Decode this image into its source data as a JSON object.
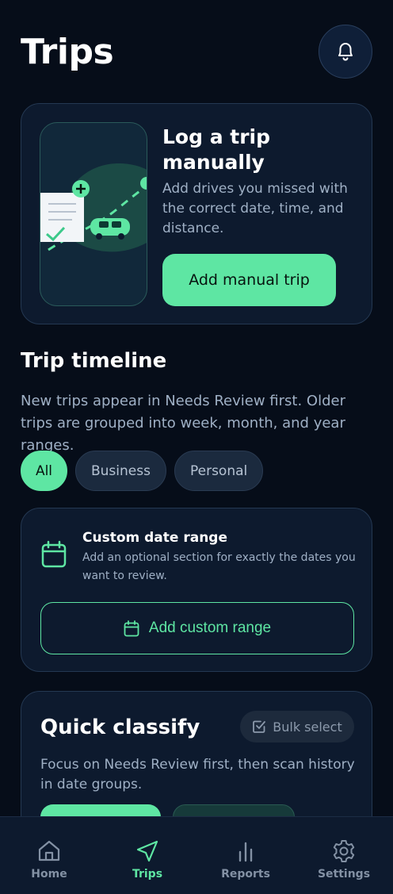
{
  "header": {
    "title": "Trips",
    "bell_icon": "bell-icon"
  },
  "manual_card": {
    "title": "Log a trip manually",
    "description": "Add drives you missed with the correct date, time, and distance.",
    "button_label": "Add manual trip",
    "illustration_icons": [
      "document-icon",
      "plus-icon",
      "check-icon",
      "car-icon",
      "location-pin-icon"
    ]
  },
  "timeline": {
    "title": "Trip timeline",
    "description": "New trips appear in Needs Review first. Older trips are grouped into week, month, and year ranges.",
    "filters": [
      {
        "label": "All",
        "active": true
      },
      {
        "label": "Business",
        "active": false
      },
      {
        "label": "Personal",
        "active": false
      }
    ]
  },
  "custom_range": {
    "title": "Custom date range",
    "description": "Add an optional section for exactly the dates you want to review.",
    "button_label": "Add custom range",
    "icon": "calendar-icon"
  },
  "quick_classify": {
    "title": "Quick classify",
    "bulk_label": "Bulk select",
    "bulk_icon": "checkbox-icon",
    "description": "Focus on Needs Review first, then scan history in date groups."
  },
  "nav": {
    "items": [
      {
        "label": "Home",
        "icon": "home-icon",
        "active": false
      },
      {
        "label": "Trips",
        "icon": "navigation-arrow-icon",
        "active": true
      },
      {
        "label": "Reports",
        "icon": "bar-chart-icon",
        "active": false
      },
      {
        "label": "Settings",
        "icon": "gear-icon",
        "active": false
      }
    ]
  },
  "colors": {
    "background": "#060d19",
    "card": "#0d1a2e",
    "accent": "#5ee6a3",
    "muted_text": "#9fb0c5"
  }
}
